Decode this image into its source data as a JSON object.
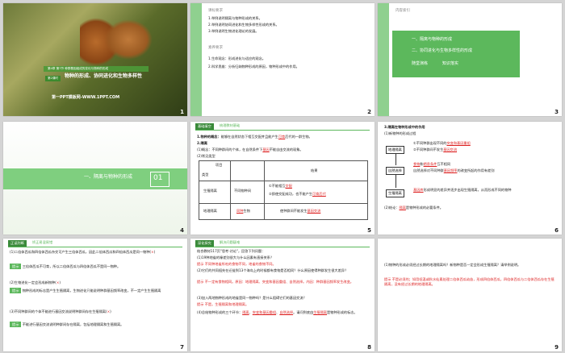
{
  "slides": {
    "s1": {
      "number": "1",
      "header": "第4章 第7节 种群基因组成的变化与物种的形成",
      "tag": "第2课时",
      "title": "物种的形成、协同进化和生物多样性",
      "footer": "第一PPT模板网-WWW.1PPT.COM"
    },
    "s2": {
      "number": "2",
      "section1_title": "课标要求",
      "section1_lines": [
        "1.举例说明隔离与物种形成的关系。",
        "2.举例说明协同进化和生物多样性形成的关系。",
        "3.举例说明生物进化理论的发展。"
      ],
      "section2_title": "素养要求",
      "section2_lines": [
        "1.生命观念：形成进化与适应的观念。",
        "2.科学思维：分析归纳物种形成的原因，物种形成中的作用。"
      ]
    },
    "s3": {
      "number": "3",
      "title": "内容索引",
      "items": [
        "一、隔离与物种的形成",
        "二、协同进化与生物多样性的形成"
      ],
      "sub_items": [
        "随堂演练",
        "知识落实"
      ]
    },
    "s4": {
      "number": "4",
      "section_title": "一、隔离与物种的形成",
      "section_number": "01"
    },
    "s5": {
      "number": "5",
      "banner": "基础填空",
      "banner2": "梳理教材基础",
      "line1_prefix": "1.物种的概念：",
      "line1": "能够在自然状态下相互交配并且能产生",
      "line1_blank": "可育",
      "line1_suffix": "后代的一群生物。",
      "line2": "2.隔离",
      "line3_prefix": "(1)概念：不同种群间的个体，在自然条件下",
      "line3_blank": "基因",
      "line3_suffix": "不能自由交流的现象。",
      "line4": "(2)常见类型",
      "table_header_item": "项目",
      "table_header_type": "类型",
      "table_header_col1": "",
      "table_header_col2": "结果",
      "row1_type": "生殖隔离",
      "row1_col1": "不同物种间",
      "row1_result1": "①不能相互",
      "row1_result1_blank": "交配",
      "row1_result2": "②即使交配成功，也不能产生",
      "row1_result2_blank": "可育后代",
      "row2_type": "地理隔离",
      "row2_col1_blank": "同种",
      "row2_col1": "生物",
      "row2_result": "使种群间不能发生",
      "row2_result_blank": "基因交流"
    },
    "s6": {
      "number": "6",
      "title": "3.隔离在物种形成中的作用",
      "line1": "(1)新物种的形成过程",
      "box1": "地理隔离",
      "arrow1a": "①不同种群出现不同的",
      "arrow1a_blank": "突变和基因重组",
      "arrow1b": "②不同种群间不发生",
      "arrow1b_blank": "基因交流",
      "box2": "自然选择",
      "arrow2a_blank": "食物",
      "arrow2a": "和",
      "arrow2a_blank2": "栖息条件",
      "arrow2a_suffix": "互不相同",
      "arrow2b": "自然选择对不同种群",
      "arrow2b_blank": "基因频率",
      "arrow2b_suffix": "的改变所起的作用有差别",
      "box3": "生殖隔离",
      "arrow3_blank": "基因库",
      "arrow3": "形成明显的差异并逐步出现生殖隔离，从而形成不同的物种",
      "line_end": "(2)结论：",
      "line_end_blank": "隔离",
      "line_end_suffix": "是物种形成的必要条件。"
    },
    "s7": {
      "number": "7",
      "banner": "正误判断",
      "banner2": "矫正易混易错",
      "q1": "(1)二倍体西瓜和四倍体西瓜杂交可产生三倍体西瓜，因此二倍体西瓜和四倍体西瓜是同一物种(",
      "q1_mark": "×",
      "q1_end": ")",
      "a1_label": "提示",
      "a1": "三倍体西瓜不可育，所以二倍体西瓜与四倍体西瓜不是同一物种。",
      "q2": "(2)生物进化一定会形成新物种(",
      "q2_mark": "×",
      "q2_end": ")",
      "a2_label": "提示",
      "a2": "物种形成的标志是产生生殖隔离，生物进化只能说明种群基因频率改变，不一定产生生殖隔离",
      "q3": "(3)不同种群间的个体不能进行基因交流说明种群间存在生殖隔离(",
      "q3_mark": "×",
      "q3_end": ")",
      "a3_label": "提示",
      "a3": "不能进行基因交流说明种群间存在隔离，包括地理隔离和生殖隔离。"
    },
    "s8": {
      "number": "8",
      "banner": "深化探究",
      "banner2": "解决问题疑难",
      "intro": "结合教材117页\"思考·讨论\"，回答下列问题：",
      "q1": "(1)19种地雀的喙差别很大与什么因素有直接关系？",
      "a1_label": "提示",
      "a1": "不同种地雀所吃的食物不同，地雀的食物不同。",
      "q2": "(2)它们的共同祖先在迁徙到13个海岛上的时候都有食物是否相同？什么原因使得种群发生很大差异？",
      "a2_label": "提示",
      "a2": "不一定有食物相同。原因：地理隔离、突变和基因重组、自然选择。内因：种群基因频率发生改变。",
      "q3": "(3)加入两地物种形成的地雀是同一物种吗？是什么阻碍它们的基因交流？",
      "a3_label": "提示",
      "a3": "不是。生殖隔离和地理隔离。",
      "q4": "(4)总结物种形成的三个环节：",
      "q4_blank1": "隔离",
      "q4_blank2": "突变和基因重组",
      "q4_blank3": "自然选择",
      "q4_suffix": "。请问到底由",
      "q4_end_blank": "生殖隔离",
      "q4_end": "是物种形成的标志。"
    },
    "s9": {
      "number": "9",
      "q": "(1)物种的形成必须经过长期的地理隔离吗？新物种是否一定会形成生殖隔离？请举例说明。",
      "a_label": "提示",
      "a": "不是必须的；如用低温或秋水仙素处理二倍体西瓜幼苗，形成四倍体西瓜，四倍体西瓜与二倍体西瓜存在生殖隔离，没有经过长期的地理隔离。"
    }
  },
  "colors": {
    "accent": "#5cb85c",
    "background": "#d4d4d4",
    "blank_red": "#dd2222"
  }
}
